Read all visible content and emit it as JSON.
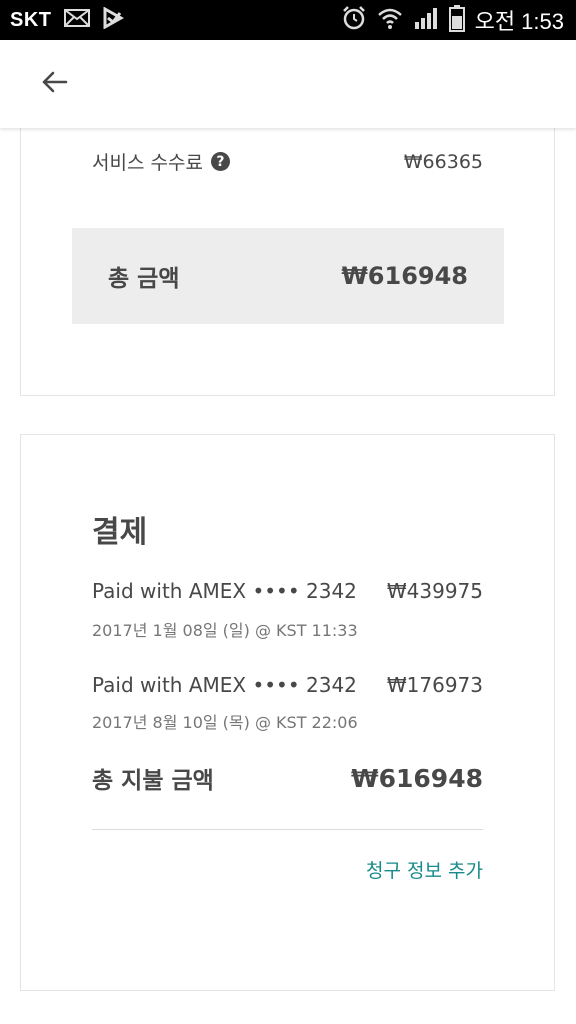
{
  "status_bar": {
    "carrier": "SKT",
    "time": "오전 1:53",
    "icons": [
      "mail-icon",
      "play-store-icon",
      "alarm-icon",
      "wifi-icon",
      "signal-icon",
      "battery-icon"
    ]
  },
  "app_bar": {
    "back_icon": "arrow-left-icon"
  },
  "price_summary": {
    "service_fee_label": "서비스 수수료",
    "service_fee_help": "?",
    "service_fee_value": "₩66365",
    "total_label": "총 금액",
    "total_value": "₩616948"
  },
  "payment": {
    "title": "결제",
    "items": [
      {
        "method": "Paid with AMEX •••• 2342",
        "amount": "₩439975",
        "date": "2017년 1월 08일 (일) @ KST 11:33"
      },
      {
        "method": "Paid with AMEX •••• 2342",
        "amount": "₩176973",
        "date": "2017년 8월 10일 (목) @ KST 22:06"
      }
    ],
    "total_paid_label": "총 지불 금액",
    "total_paid_value": "₩616948",
    "billing_link": "청구 정보 추가"
  },
  "colors": {
    "link": "#1a8a8a",
    "text": "#484848",
    "muted": "#767676",
    "total_bg": "#ededed"
  }
}
